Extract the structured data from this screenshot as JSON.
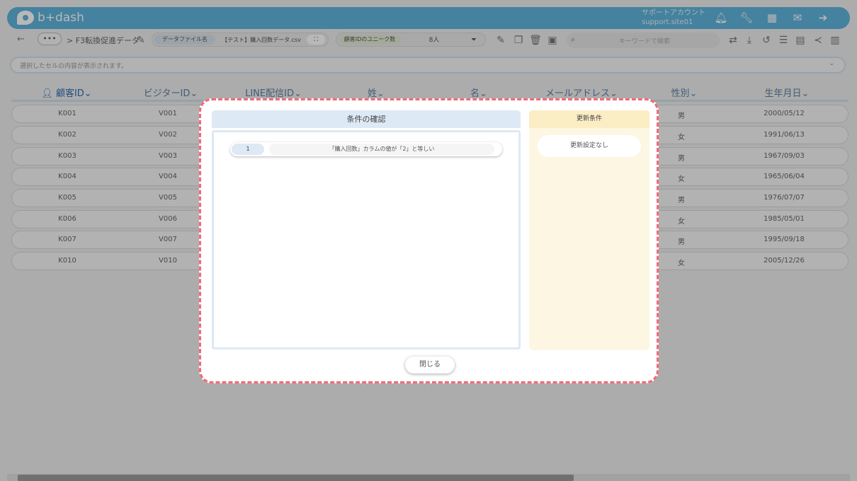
{
  "header": {
    "logo_text": "b+dash",
    "account_name": "サポートアカウント",
    "account_site": "support.site01",
    "icons": [
      "bell-icon",
      "wrench-icon",
      "apps-icon",
      "chat-icon",
      "logout-icon"
    ]
  },
  "toolbar": {
    "back": "←",
    "more": "•••",
    "breadcrumb": "> F3転換促進データ",
    "file_label": "データファイル名",
    "file_value": "【テスト】購入回数データ.csv",
    "unique_label": "顧客IDのユニーク数",
    "unique_value": "8人",
    "search_placeholder": "キーワードで検索"
  },
  "cell_bar": {
    "placeholder": "選択したセルの内容が表示されます。"
  },
  "table": {
    "columns": [
      "顧客ID",
      "ビジターID",
      "LINE配信ID",
      "姓",
      "名",
      "メールアドレス",
      "性別",
      "生年月日"
    ],
    "rows": [
      {
        "id": "K001",
        "visitor": "V001",
        "gender": "男",
        "dob": "2000/05/12"
      },
      {
        "id": "K002",
        "visitor": "V002",
        "gender": "女",
        "dob": "1991/06/13"
      },
      {
        "id": "K003",
        "visitor": "V003",
        "gender": "男",
        "dob": "1967/09/03"
      },
      {
        "id": "K004",
        "visitor": "V004",
        "gender": "女",
        "dob": "1965/06/04"
      },
      {
        "id": "K005",
        "visitor": "V005",
        "gender": "男",
        "dob": "1976/07/07"
      },
      {
        "id": "K006",
        "visitor": "V006",
        "gender": "女",
        "dob": "1985/05/01"
      },
      {
        "id": "K007",
        "visitor": "V007",
        "gender": "男",
        "dob": "1995/09/18"
      },
      {
        "id": "K010",
        "visitor": "V010",
        "gender": "女",
        "dob": "2005/12/26"
      }
    ]
  },
  "modal": {
    "conditions_title": "条件の確認",
    "conditions": [
      {
        "num": "1",
        "text": "「購入回数」カラムの値が「2」と等しい"
      }
    ],
    "update_title": "更新条件",
    "update_value": "更新設定なし",
    "close_label": "閉じる"
  }
}
